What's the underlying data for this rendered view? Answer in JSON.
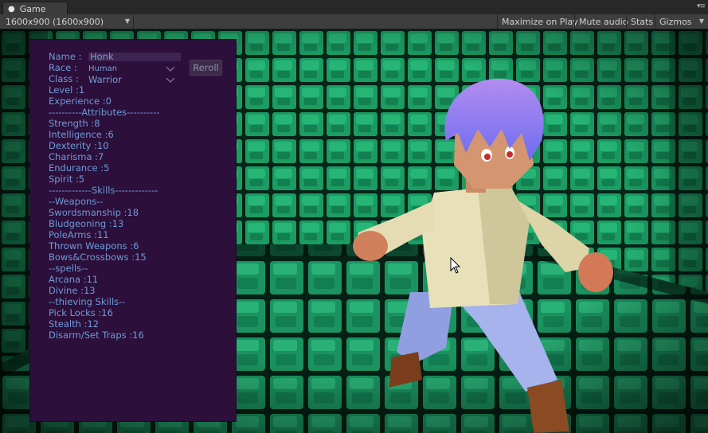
{
  "window": {
    "tab_title": "Game"
  },
  "toolbar": {
    "resolution": "1600x900 (1600x900)",
    "maximize_on_play": "Maximize on Play",
    "mute_audio": "Mute audio",
    "stats": "Stats",
    "gizmos": "Gizmos"
  },
  "character": {
    "name_label": "Name :",
    "name_value": "Honk",
    "race_label": "Race :",
    "race_value": "Human",
    "class_label": "Class :",
    "class_value": "Warrior",
    "reroll_label": "Reroll",
    "level": "Level :1",
    "experience": "Experience :0",
    "attributes_header": "----------Attributes----------",
    "attributes": [
      "Strength :8",
      "Intelligence :6",
      "Dexterity :10",
      "Charisma :7",
      "Endurance :5",
      "Spirit :5"
    ],
    "skills_header": "-------------Skills-------------",
    "weapons_header": "--Weapons--",
    "weapons": [
      "Swordsmanship :18",
      "Bludgeoning :13",
      "PoleArms :11",
      "Thrown Weapons :6",
      "Bows&Crossbows :15"
    ],
    "spells_header": "--spells--",
    "spells": [
      "Arcana :11",
      "Divine :13"
    ],
    "thieving_header": "--thieving Skills--",
    "thieving": [
      "Pick Locks :16",
      "Stealth :12",
      "Disarm/Set Traps :16"
    ]
  },
  "colors": {
    "panel_bg": "#2c0f3a",
    "panel_text": "#6e9bd8",
    "tile_green": "#1fa36a"
  }
}
